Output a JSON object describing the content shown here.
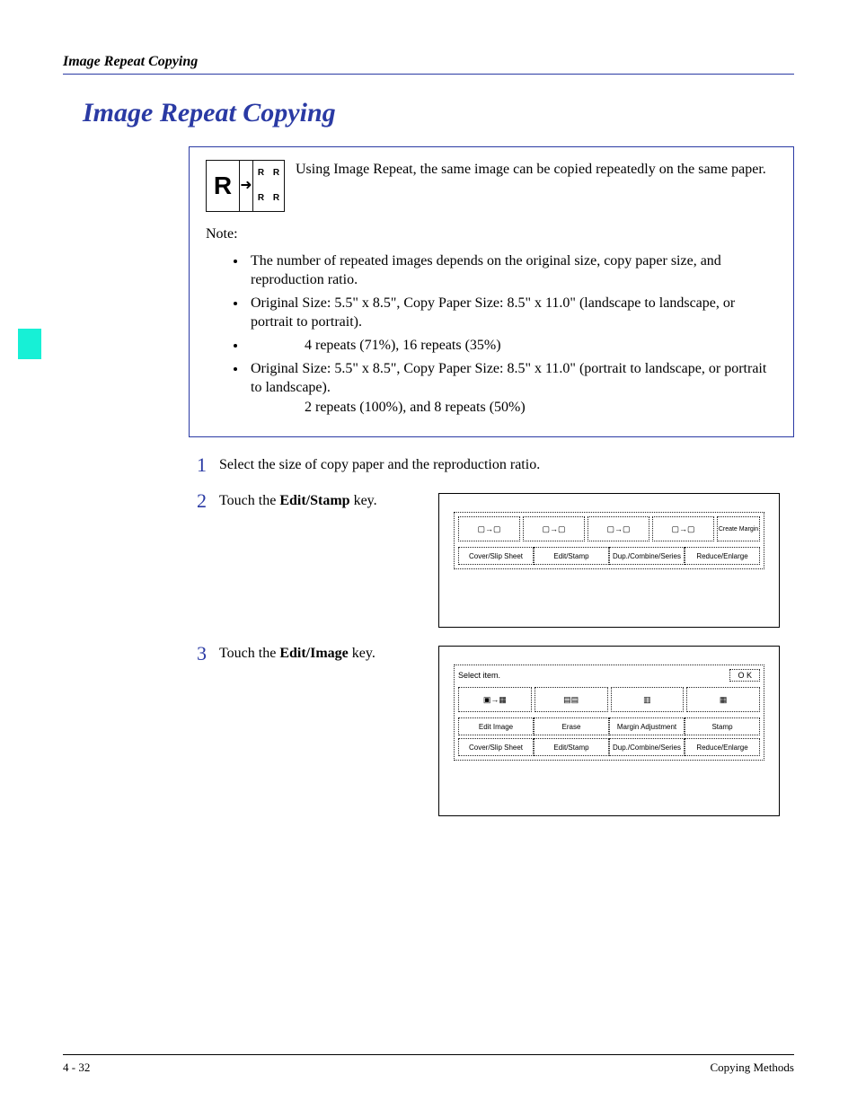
{
  "header": {
    "running_title": "Image Repeat Copying"
  },
  "title": "Image Repeat Copying",
  "intro": {
    "text": "Using Image Repeat, the same image can be copied repeatedly on the same paper.",
    "note_label": "Note:",
    "notes": {
      "n1": "The number of repeated images depends on the original size, copy paper size, and reproduction ratio.",
      "n2": "Original Size: 5.5\" x 8.5\", Copy Paper Size: 8.5\" x 11.0\" (landscape to landscape, or portrait to portrait).",
      "n3": "4 repeats (71%), 16 repeats (35%)",
      "n4": "Original Size: 5.5\" x 8.5\", Copy Paper Size: 8.5\" x 11.0\" (portrait to landscape, or portrait to landscape).",
      "n4b": "2 repeats (100%), and 8 repeats (50%)"
    }
  },
  "steps": {
    "s1": {
      "num": "1",
      "text": "Select the size of copy paper and the reproduction ratio."
    },
    "s2": {
      "num": "2",
      "pre": "Touch the ",
      "bold": "Edit/Stamp",
      "post": " key."
    },
    "s3": {
      "num": "3",
      "pre": "Touch the ",
      "bold": "Edit/Image",
      "post": " key."
    }
  },
  "panels": {
    "p1": {
      "create_margin": "Create Margin",
      "buttons": {
        "b1": "Cover/Slip Sheet",
        "b2": "Edit/Stamp",
        "b3": "Dup./Combine/Series",
        "b4": "Reduce/Enlarge"
      }
    },
    "p2": {
      "select_item": "Select item.",
      "ok": "O K",
      "row1": {
        "b1": "Edit Image",
        "b2": "Erase",
        "b3": "Margin Adjustment",
        "b4": "Stamp"
      },
      "row2": {
        "b1": "Cover/Slip Sheet",
        "b2": "Edit/Stamp",
        "b3": "Dup./Combine/Series",
        "b4": "Reduce/Enlarge"
      }
    }
  },
  "footer": {
    "left": "4 - 32",
    "right": "Copying Methods"
  }
}
